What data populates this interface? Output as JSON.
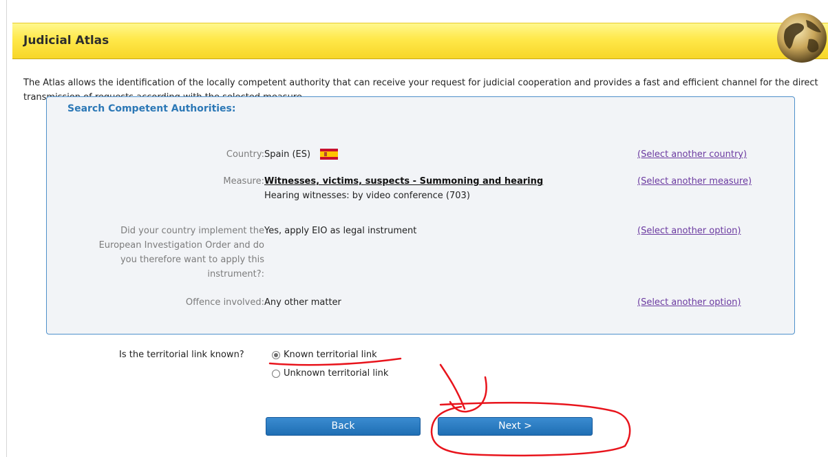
{
  "header": {
    "title": "Judicial Atlas"
  },
  "intro": "The Atlas allows the identification of the locally competent authority that can receive your request for judicial cooperation and provides a fast and efficient channel for the direct transmission of requests according with the selected measure.",
  "search": {
    "title": "Search Competent Authorities:",
    "country": {
      "label": "Country:",
      "value": "Spain (ES)",
      "link": "(Select another country)"
    },
    "measure": {
      "label": "Measure:",
      "value": "Witnesses, victims, suspects - Summoning and hearing",
      "sub": "Hearing witnesses: by video conference (703)",
      "link": "(Select another measure)"
    },
    "eio": {
      "label": "Did your country implement the European Investigation Order and do you therefore want to apply this instrument?:",
      "value": "Yes, apply EIO as legal instrument",
      "link": "(Select another option)"
    },
    "offence": {
      "label": "Offence involved:",
      "value": "Any other matter",
      "link": "(Select another option)"
    }
  },
  "territorial": {
    "label": "Is the territorial link known?",
    "options": [
      {
        "label": "Known territorial link",
        "selected": true
      },
      {
        "label": "Unknown territorial link",
        "selected": false
      }
    ]
  },
  "buttons": {
    "back": "Back",
    "next": "Next >"
  },
  "colors": {
    "header_yellow": "#ffe84a",
    "accent_blue": "#2c78b6",
    "link_purple": "#6b3aa0",
    "annotation_red": "#e8141c"
  }
}
